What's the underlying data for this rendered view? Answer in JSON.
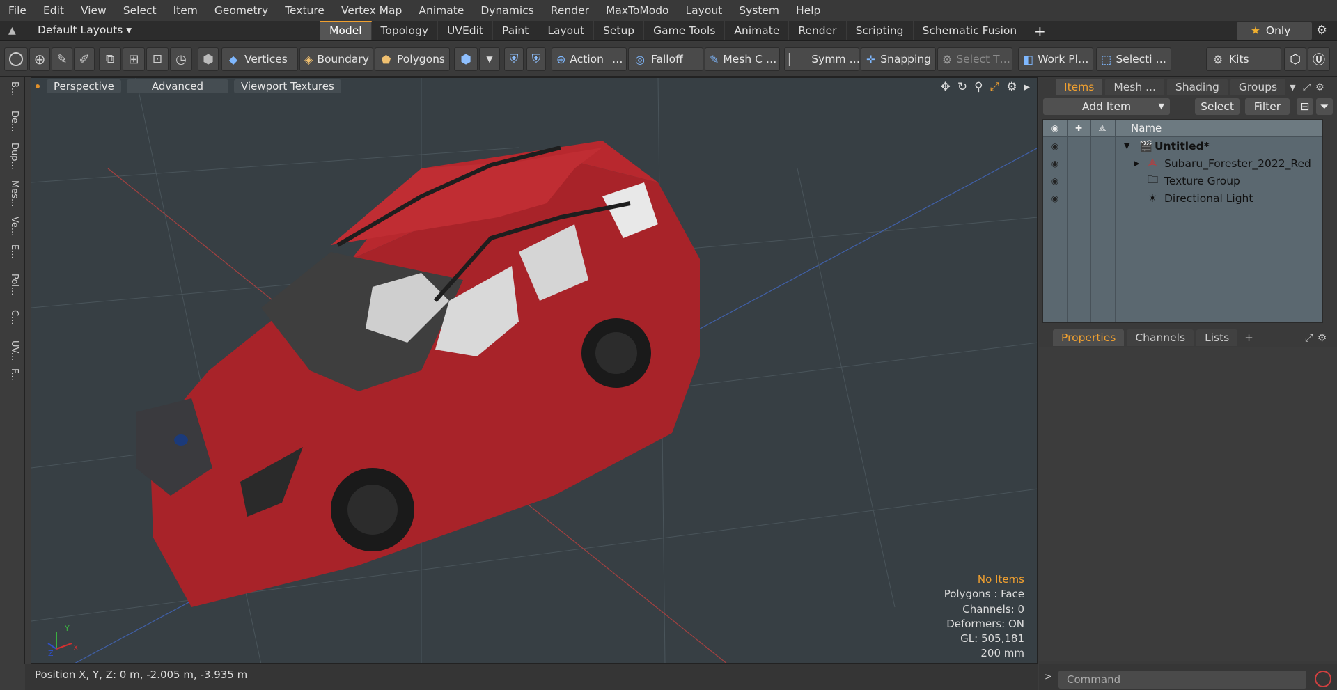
{
  "menu": [
    "File",
    "Edit",
    "View",
    "Select",
    "Item",
    "Geometry",
    "Texture",
    "Vertex Map",
    "Animate",
    "Dynamics",
    "Render",
    "MaxToModo",
    "Layout",
    "System",
    "Help"
  ],
  "layouts": {
    "selector": "Default Layouts ▾",
    "tabs": [
      "Model",
      "Topology",
      "UVEdit",
      "Paint",
      "Layout",
      "Setup",
      "Game Tools",
      "Animate",
      "Render",
      "Scripting",
      "Schematic Fusion"
    ],
    "active": "Model",
    "plus": "+",
    "only": "Only"
  },
  "toolbar": {
    "vertices": "Vertices",
    "boundary": "Boundary",
    "polygons": "Polygons",
    "action": "Action",
    "action_more": "…",
    "falloff": "Falloff",
    "mesh": "Mesh C …",
    "symm": "Symm …",
    "snapping": "Snapping",
    "select_t": "Select T…",
    "work_plane": "Work Pl…",
    "selecti": "Selecti …",
    "kits": "Kits"
  },
  "left_tabs": [
    "B...",
    "De...",
    "Dup...",
    "Mes...",
    "Ve...",
    "E...",
    "Pol...",
    "C...",
    "UV...",
    "F..."
  ],
  "viewport": {
    "buttons": [
      "Perspective",
      "Advanced",
      "Viewport Textures"
    ],
    "stats": {
      "no_items": "No Items",
      "polygons": "Polygons : Face",
      "channels": "Channels: 0",
      "deformers": "Deformers: ON",
      "gl": "GL: 505,181",
      "scale": "200 mm"
    },
    "axis": {
      "x": "X",
      "y": "Y",
      "z": "Z"
    }
  },
  "status": {
    "position": "Position X, Y, Z:   0 m, -2.005 m, -3.935 m"
  },
  "items_panel": {
    "tabs": [
      "Items",
      "Mesh ...",
      "Shading",
      "Groups"
    ],
    "add_item": "Add Item",
    "select": "Select",
    "filter": "Filter",
    "col_name": "Name",
    "rows": [
      {
        "name": "Untitled*",
        "level": 0
      },
      {
        "name": "Subaru_Forester_2022_Red",
        "level": 1
      },
      {
        "name": "Texture Group",
        "level": 1
      },
      {
        "name": "Directional Light",
        "level": 1
      }
    ]
  },
  "props_panel": {
    "tabs": [
      "Properties",
      "Channels",
      "Lists"
    ],
    "plus": "+"
  },
  "command": {
    "placeholder": "Command"
  },
  "colors": {
    "car_body": "#b3262c",
    "accent": "#f0a030"
  }
}
